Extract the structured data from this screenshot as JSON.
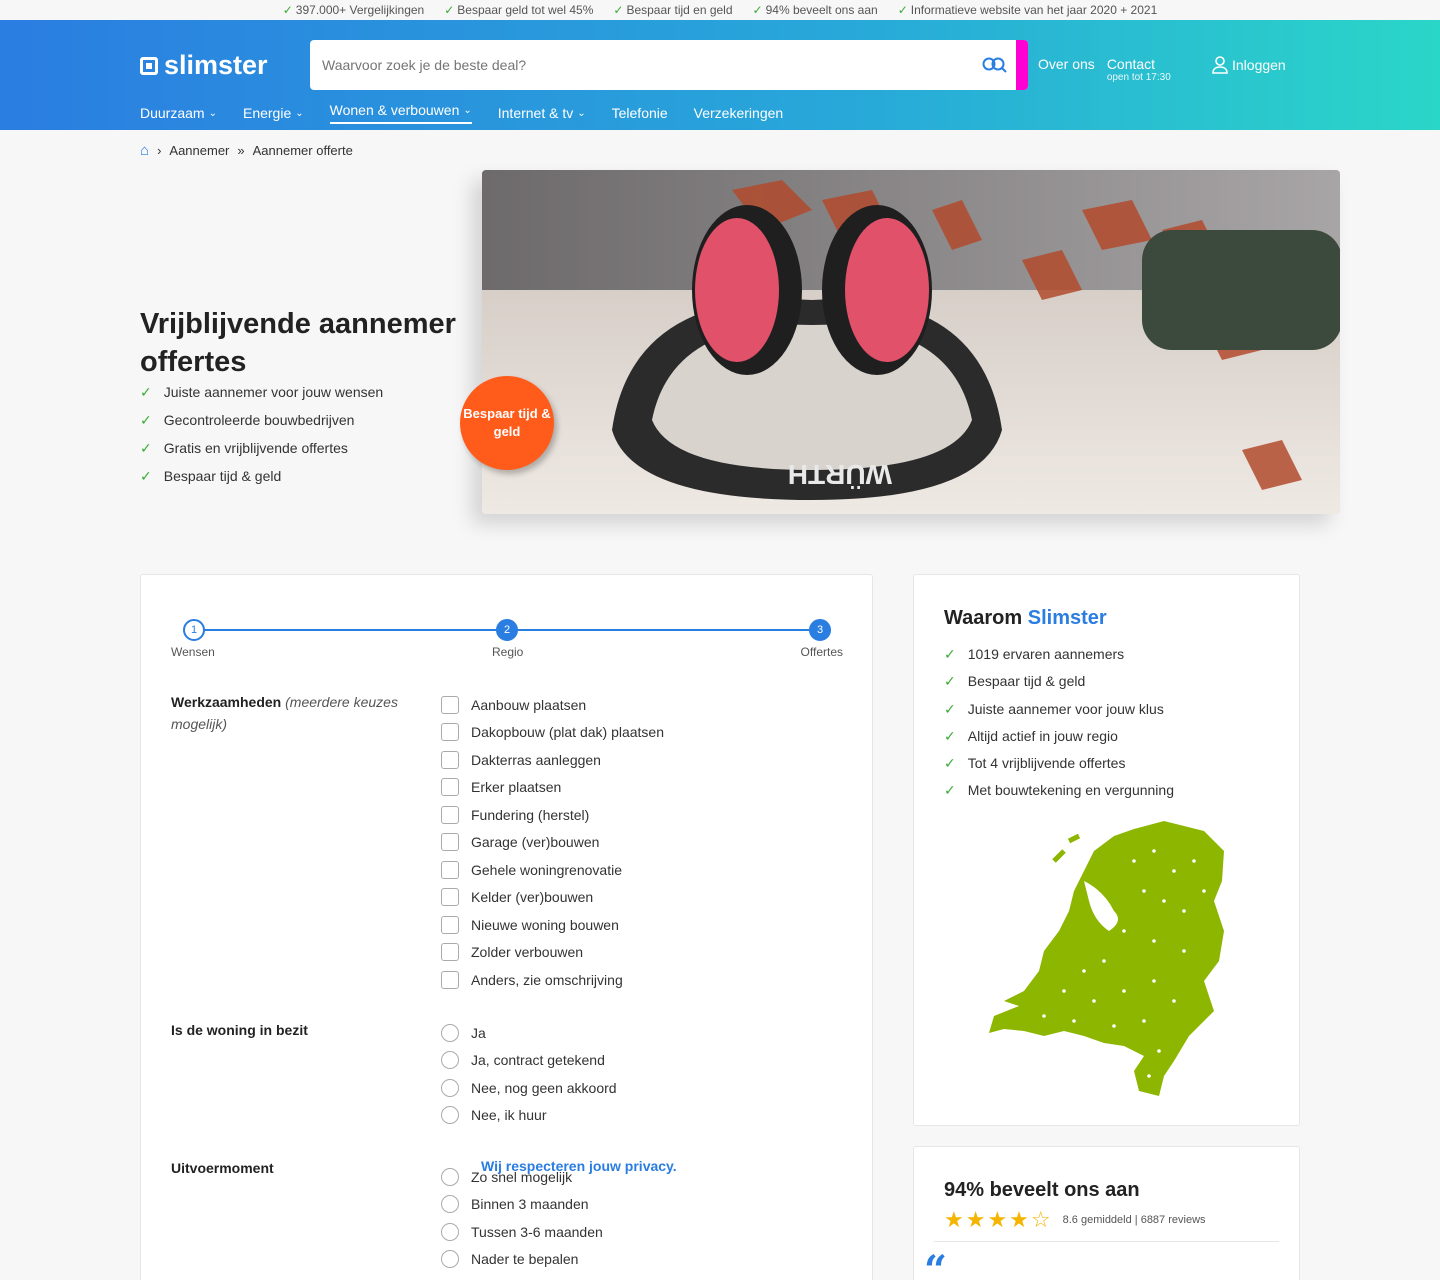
{
  "usp": [
    "397.000+ Vergelijkingen",
    "Bespaar geld tot wel 45%",
    "Bespaar tijd en geld",
    "94% beveelt ons aan",
    "Informatieve website van het jaar 2020 + 2021"
  ],
  "header": {
    "logo": "slimster",
    "search_placeholder": "Waarvoor zoek je de beste deal?",
    "about": "Over ons",
    "contact": "Contact",
    "contact_sub": "open tot 17:30",
    "login": "Inloggen"
  },
  "nav": [
    {
      "label": "Duurzaam",
      "has_dropdown": true
    },
    {
      "label": "Energie",
      "has_dropdown": true
    },
    {
      "label": "Wonen & verbouwen",
      "has_dropdown": true,
      "active": true
    },
    {
      "label": "Internet & tv",
      "has_dropdown": true
    },
    {
      "label": "Telefonie",
      "has_dropdown": false
    },
    {
      "label": "Verzekeringen",
      "has_dropdown": false
    }
  ],
  "breadcrumb": {
    "level1": "Aannemer",
    "level2": "Aannemer offerte"
  },
  "hero": {
    "title": "Vrijblijvende aannemer offertes",
    "bullets": [
      "Juiste aannemer voor jouw wensen",
      "Gecontroleerde bouwbedrijven",
      "Gratis en vrijblijvende offertes",
      "Bespaar tijd & geld"
    ],
    "badge": "Bespaar tijd & geld"
  },
  "form": {
    "steps": [
      "Wensen",
      "Regio",
      "Offertes"
    ],
    "q1": {
      "label": "Werkzaamheden",
      "hint": "(meerdere keuzes mogelijk)",
      "options": [
        "Aanbouw plaatsen",
        "Dakopbouw (plat dak) plaatsen",
        "Dakterras aanleggen",
        "Erker plaatsen",
        "Fundering (herstel)",
        "Garage (ver)bouwen",
        "Gehele woningrenovatie",
        "Kelder (ver)bouwen",
        "Nieuwe woning bouwen",
        "Zolder verbouwen",
        "Anders, zie omschrijving"
      ]
    },
    "q2": {
      "label": "Is de woning in bezit",
      "options": [
        "Ja",
        "Ja, contract getekend",
        "Nee, nog geen akkoord",
        "Nee, ik huur"
      ]
    },
    "q3": {
      "label": "Uitvoermoment",
      "options": [
        "Zo snel mogelijk",
        "Binnen 3 maanden",
        "Tussen 3-6 maanden",
        "Nader te bepalen"
      ]
    },
    "privacy": "Wij respecteren jouw privacy."
  },
  "why": {
    "title_prefix": "Waarom",
    "title_brand": "Slimster",
    "items": [
      "1019 ervaren aannemers",
      "Bespaar tijd & geld",
      "Juiste aannemer voor jouw klus",
      "Altijd actief in jouw regio",
      "Tot 4 vrijblijvende offertes",
      "Met bouwtekening en vergunning"
    ]
  },
  "reviews": {
    "title": "94% beveelt ons aan",
    "stars": "★★★★☆",
    "summary": "8.6 gemiddeld | 6887 reviews",
    "quote_mark": "“"
  },
  "colors": {
    "brand_blue": "#2a7de1",
    "teal": "#2ad6c8",
    "check_green": "#3aaa35",
    "badge_orange": "#ff5b1b",
    "map_green": "#8db600"
  }
}
